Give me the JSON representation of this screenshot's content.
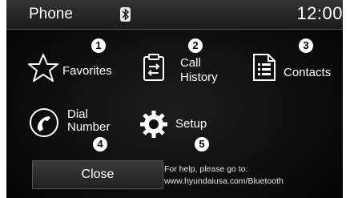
{
  "app_title": "Phone",
  "status": {
    "clock": "12:00",
    "bluetooth_icon": "bluetooth-icon"
  },
  "menu": [
    {
      "id": "favorites",
      "label": "Favorites",
      "number": "1",
      "icon": "star-icon"
    },
    {
      "id": "call-history",
      "label_line1": "Call",
      "label_line2": "History",
      "number": "2",
      "icon": "call-history-icon"
    },
    {
      "id": "contacts",
      "label": "Contacts",
      "number": "3",
      "icon": "contacts-icon"
    },
    {
      "id": "dial-number",
      "label_line1": "Dial",
      "label_line2": "Number",
      "number": "4",
      "icon": "phone-handset-icon"
    },
    {
      "id": "setup",
      "label": "Setup",
      "number": "5",
      "icon": "gear-icon"
    }
  ],
  "close_label": "Close",
  "help": {
    "line1": "For help, please go to:",
    "line2": "www.hyundaiusa.com/Bluetooth"
  }
}
